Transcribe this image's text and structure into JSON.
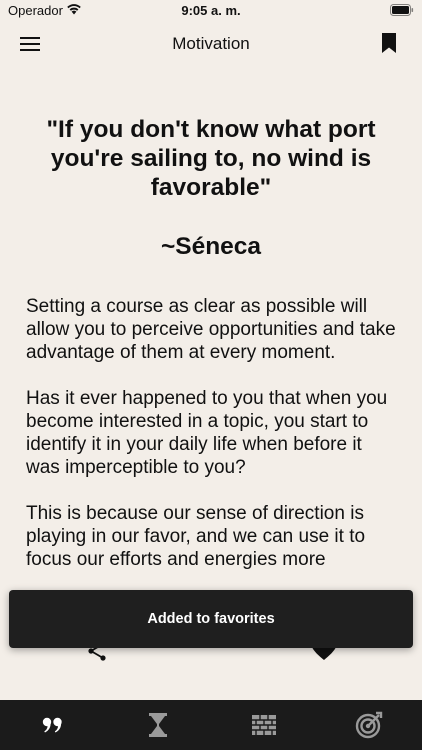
{
  "status_bar": {
    "carrier": "Operador",
    "time": "9:05 a. m."
  },
  "nav": {
    "title": "Motivation",
    "menu_icon": "hamburger-menu-icon",
    "bookmark_icon": "bookmark-icon"
  },
  "quote": {
    "text": "\"If you don't know what port you're sailing to, no wind is favorable\"",
    "author": "~Séneca"
  },
  "body": {
    "paragraphs": [
      "Setting a course as clear as possible will allow you to perceive opportunities and take advantage of them at every moment.",
      "Has it ever happened to you that when you become interested in a topic, you start to identify it in your daily life when before it was imperceptible to you?",
      "This is because our sense of direction is playing in our favor, and we can use it to focus our efforts and energies more"
    ]
  },
  "actions": {
    "share_icon": "share-icon",
    "favorite_icon": "heart-icon"
  },
  "toast": {
    "message": "Added to favorites"
  },
  "tab_bar": {
    "tabs": [
      {
        "icon": "quote-icon",
        "active": true
      },
      {
        "icon": "hourglass-icon",
        "active": false
      },
      {
        "icon": "brick-wall-icon",
        "active": false
      },
      {
        "icon": "target-icon",
        "active": false
      }
    ]
  },
  "colors": {
    "background": "#f3eee8",
    "toast_bg": "#1f1f1f",
    "tab_bar_bg": "#1b1b1b",
    "tab_active": "#ffffff",
    "tab_inactive": "#9a9a9a"
  }
}
